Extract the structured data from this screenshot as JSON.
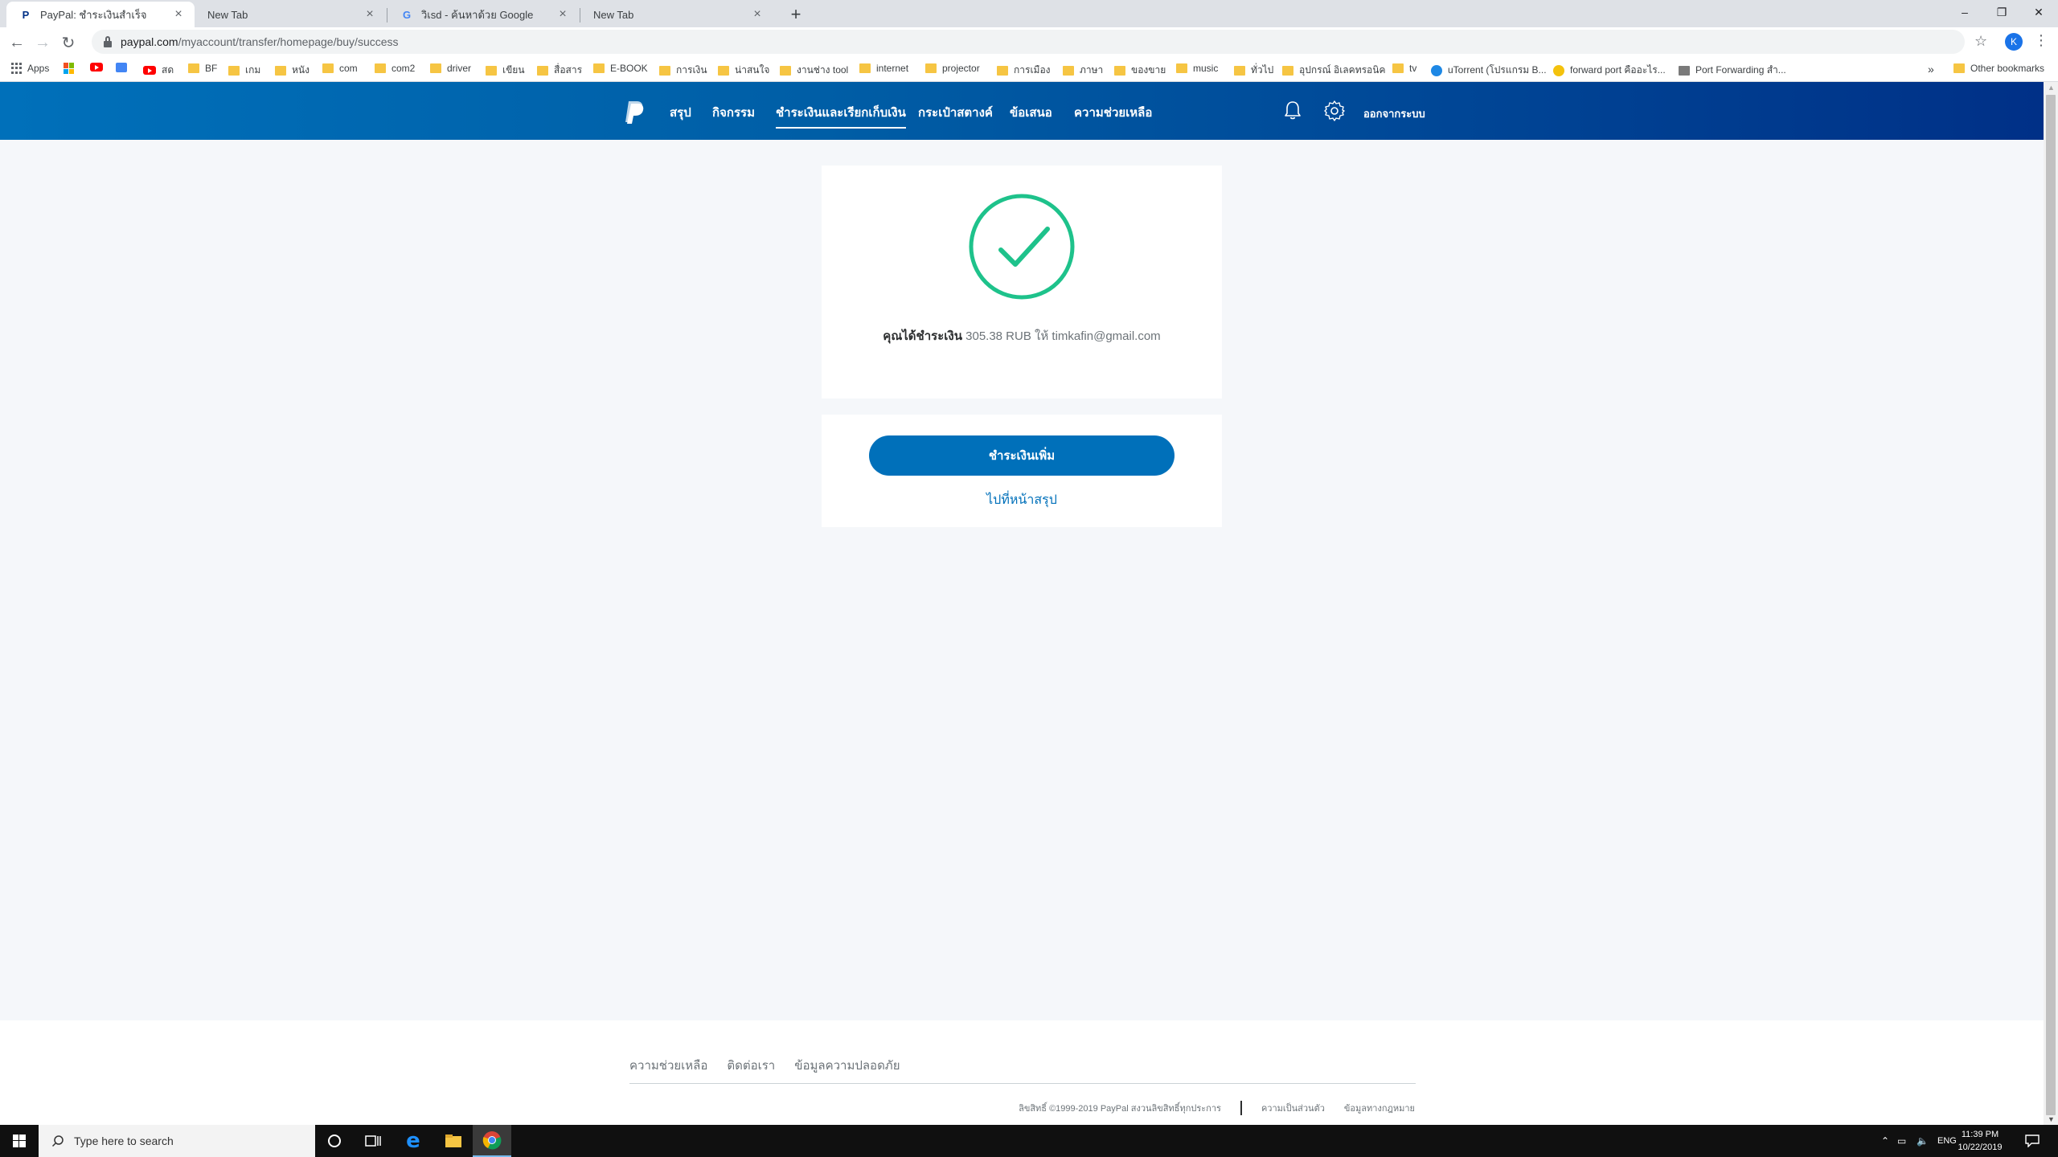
{
  "browser": {
    "tabs": [
      {
        "title": "PayPal: ชำระเงินสำเร็จ",
        "active": true
      },
      {
        "title": "New Tab",
        "active": false
      },
      {
        "title": "วิเsd - ค้นหาด้วย Google",
        "active": false
      },
      {
        "title": "New Tab",
        "active": false
      }
    ],
    "url_host": "paypal.com",
    "url_path": "/myaccount/transfer/homepage/buy/success",
    "profile_initial": "K",
    "bookmarks": [
      "Apps",
      "สด",
      "BF",
      "เกม",
      "หนัง",
      "com",
      "com2",
      "driver",
      "เขียน",
      "สื่อสาร",
      "E-BOOK",
      "การเงิน",
      "น่าสนใจ",
      "งานช่าง tool",
      "internet",
      "projector",
      "การเมือง",
      "ภาษา",
      "ของขาย",
      "music",
      "ทั่วไป",
      "อุปกรณ์ อิเลคทรอนิค",
      "tv",
      "uTorrent (โปรแกรม B...",
      "forward port คืออะไร...",
      "Port Forwarding สำ...",
      "Other bookmarks"
    ]
  },
  "paypal": {
    "nav": [
      "สรุป",
      "กิจกรรม",
      "ชำระเงินและเรียกเก็บเงิน",
      "กระเป๋าสตางค์",
      "ข้อเสนอ",
      "ความช่วยเหลือ"
    ],
    "active_nav_index": 2,
    "logout_label": "ออกจากระบบ",
    "success": {
      "prefix": "คุณได้ชำระเงิน",
      "amount": "305.38 RUB",
      "to_label": "ให้",
      "recipient": "timkafin@gmail.com"
    },
    "pay_more_label": "ชำระเงินเพิ่ม",
    "go_summary_label": "ไปที่หน้าสรุป",
    "footer": {
      "links": [
        "ความช่วยเหลือ",
        "ติดต่อเรา",
        "ข้อมูลความปลอดภัย"
      ],
      "copyright": "ลิขสิทธิ์ ©1999-2019 PayPal สงวนลิขสิทธิ์ทุกประการ",
      "privacy": "ความเป็นส่วนตัว",
      "legal": "ข้อมูลทางกฎหมาย"
    },
    "colors": {
      "primary": "#0070ba",
      "header_dark": "#003087",
      "success": "#1ec28b"
    }
  },
  "taskbar": {
    "search_placeholder": "Type here to search",
    "language": "ENG",
    "time": "11:39 PM",
    "date": "10/22/2019"
  }
}
